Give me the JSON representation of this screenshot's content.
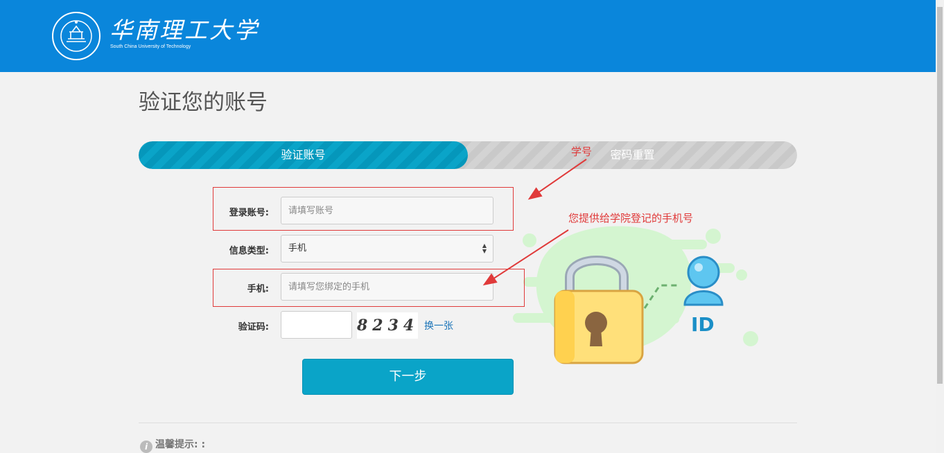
{
  "header": {
    "logo_text": "华南理工大学",
    "logo_subtitle": "South China University of Technology"
  },
  "page": {
    "title": "验证您的账号"
  },
  "steps": [
    {
      "label": "验证账号",
      "active": true
    },
    {
      "label": "密码重置",
      "active": false
    }
  ],
  "form": {
    "account": {
      "label": "登录账号:",
      "placeholder": "请填写账号"
    },
    "info_type": {
      "label": "信息类型:",
      "value": "手机"
    },
    "phone": {
      "label": "手机:",
      "placeholder": "请填写您绑定的手机"
    },
    "captcha": {
      "label": "验证码:",
      "image_text": "8234",
      "refresh": "换一张"
    },
    "next_button": "下一步"
  },
  "annotations": {
    "student_id": "学号",
    "phone_note": "您提供给学院登记的手机号"
  },
  "illustration": {
    "badge_text": "ID"
  },
  "tip": {
    "label": "温馨提示: :"
  },
  "colors": {
    "header": "#0a86db",
    "primary": "#0aa4c8",
    "annotation": "#e03a3a"
  }
}
